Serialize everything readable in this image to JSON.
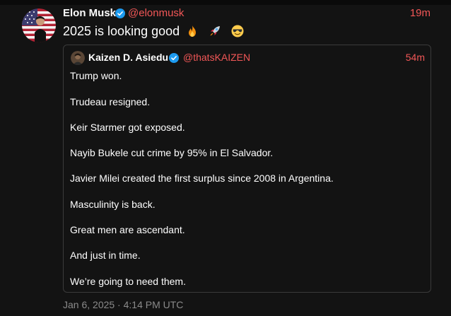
{
  "tweet": {
    "author": {
      "name": "Elon Musk",
      "handle": "@elonmusk",
      "verified": true,
      "avatar": "avatar-photo-with-flag"
    },
    "time_ago": "19m",
    "text": "2025 is looking good",
    "emojis": [
      "fire-emoji",
      "rocket-emoji",
      "sunglasses-emoji"
    ],
    "timestamp": "Jan 6, 2025 · 4:14 PM UTC"
  },
  "quoted_tweet": {
    "author": {
      "name": "Kaizen D. Asiedu",
      "handle": "@thatsKAIZEN",
      "verified": true,
      "avatar": "avatar-photo"
    },
    "time_ago": "54m",
    "lines": [
      "Trump won.",
      "Trudeau resigned.",
      "Keir Starmer got exposed.",
      "Nayib Bukele cut crime by 95% in El Salvador.",
      "Javier Milei created the first surplus since 2008 in Argentina.",
      "Masculinity is back.",
      "Great men are ascendant.",
      "And just in time.",
      "We’re going to need them."
    ]
  },
  "colors": {
    "background": "#131313",
    "accent": "#f25757",
    "verified": "#1d9bf0",
    "muted": "#8a8a8a",
    "border": "#3b3b3b"
  }
}
